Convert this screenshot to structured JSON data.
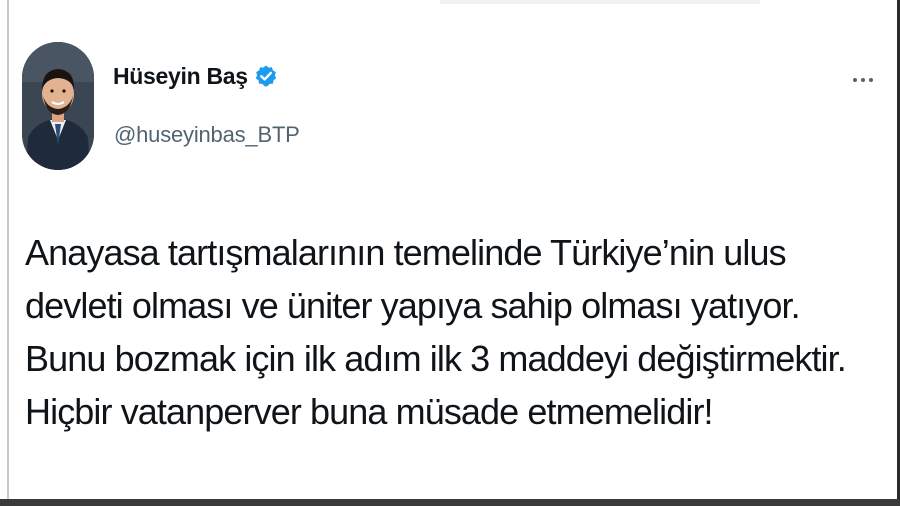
{
  "tweet": {
    "author": {
      "display_name": "Hüseyin Baş",
      "handle": "@huseyinbas_BTP",
      "verified": true,
      "verified_icon": "verified-badge-icon",
      "avatar": "profile-photo"
    },
    "more_icon": "more-dots-icon",
    "text_lines": [
      "Anayasa tartışmalarının temelinde Türkiye’nin ulus",
      "devleti olması ve üniter yapıya sahip olması yatıyor.",
      "Bunu bozmak için ilk adım ilk 3 maddeyi değiştirmektir.",
      "Hiçbir vatanperver buna müsade etmemelidir!"
    ]
  },
  "colors": {
    "verified_blue": "#1d9bf0",
    "text": "#0f1419",
    "secondary_text": "#536471"
  }
}
